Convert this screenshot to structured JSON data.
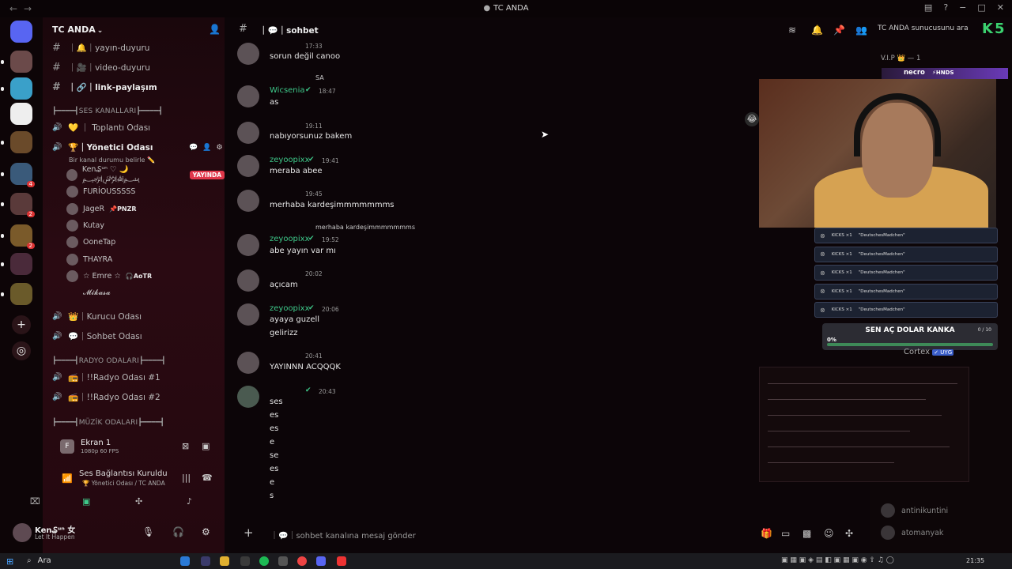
{
  "window": {
    "title": "TC ANDA",
    "controls": [
      "−",
      "□",
      "✕"
    ]
  },
  "server": {
    "name": "TC ANDA"
  },
  "text_channels": [
    {
      "icon": "📢",
      "label": "｜🔔｜yayın-duyuru"
    },
    {
      "icon": "🎥",
      "label": "｜🎥｜video-duyuru"
    },
    {
      "icon": "🔗",
      "label": "｜🔗｜link-paylaşım"
    }
  ],
  "categories": {
    "ses": "┣━━━━┫SES KANALLARI┣━━━━┫",
    "radyo": "┣━━━━┫RADYO ODALARI┣━━━━┫",
    "muzik": "┣━━━━┫MÜZİK ODALARI┣━━━━┫"
  },
  "voice_channels": {
    "toplanti": "💛 ｜ Toplantı Odası",
    "yonetici": "🏆｜Yönetici Odası",
    "yonetici_status": "Bir kanal durumu belirle ✏️",
    "kurucu": "👑｜Kurucu Odası",
    "sohbet": "💬｜Sohbet Odası",
    "radyo1": "📻｜!!Radyo Odası #1",
    "radyo2": "📻｜!!Radyo Odası #2"
  },
  "voice_users": [
    {
      "name": "Ken₷ᵘⁿ ♡ 🌙 ﷽",
      "live": "YAYINDA"
    },
    {
      "name": "FURİOUSSSSS"
    },
    {
      "name": "JageR",
      "tag": "📌PNZR"
    },
    {
      "name": "Kutay"
    },
    {
      "name": "OoneTap"
    },
    {
      "name": "THAYRA"
    },
    {
      "name": "☆ Emre ☆",
      "tag": "🎧AoTR"
    },
    {
      "name": "𝓜𝓲𝓴𝓪𝓼𝓪"
    }
  ],
  "screen_share": {
    "letter": "F",
    "title": "Ekran 1",
    "quality": "1080p 60 FPS"
  },
  "voice_status": {
    "title": "Ses Bağlantısı Kuruldu",
    "subtitle": "🏆 Yönetici Odası / TC ANDA"
  },
  "user_panel": {
    "name": "Ken₷ᵘⁿ 女",
    "status": "Let It Happen"
  },
  "channel_header": {
    "name": "｜💬｜sohbet",
    "search_placeholder": "TC ANDA sunucusunu ara"
  },
  "messages": [
    {
      "time": "17:33",
      "text": "sorun değil canoo"
    },
    {
      "reply": "SA",
      "author": "Wicsenia",
      "time": "18:47",
      "text": "as"
    },
    {
      "time": "19:11",
      "text": "nabıyorsunuz bakem"
    },
    {
      "author": "zeyoopixx",
      "time": "19:41",
      "text": "meraba abee"
    },
    {
      "time": "19:45",
      "text": "merhaba kardeşimmmmmmms"
    },
    {
      "reply": "merhaba kardeşimmmmmmms",
      "author": "zeyoopixx",
      "time": "19:52",
      "text": "abe yayın var mı"
    },
    {
      "time": "20:02",
      "text": "açıcam"
    },
    {
      "author": "zeyoopixx",
      "time": "20:06",
      "text": "ayaya guzell",
      "text2": "gelirizz"
    },
    {
      "time": "20:41",
      "text": "YAYINNN ACQQQK"
    },
    {
      "time": "20:43",
      "lines": [
        "ses",
        "es",
        "es",
        "e",
        "se",
        "es",
        "e",
        "s"
      ]
    }
  ],
  "composer": {
    "placeholder": "｜💬｜sohbet kanalına mesaj gönder"
  },
  "members": {
    "vip_header": "V.I.P 👑 — 1",
    "necro": "necro",
    "necro_tag": "⚡HNDS",
    "cortex": "Cortex",
    "cortex_tag": "✓ UYG",
    "list": [
      "antinikuntini",
      "atomanyak"
    ]
  },
  "alerts": {
    "rows": [
      {
        "who": "KICKS ×1",
        "text": "\"DeutschesMadchen\""
      },
      {
        "who": "KICKS ×1",
        "text": "\"DeutschesMadchen\""
      },
      {
        "who": "KICKS ×1",
        "text": "\"DeutschesMadchen\""
      },
      {
        "who": "KICKS ×1",
        "text": "\"DeutschesMadchen\""
      },
      {
        "who": "KICKS ×1",
        "text": "\"DeutschesMadchen\""
      }
    ]
  },
  "goal": {
    "title": "SEN AÇ DOLAR KANKA",
    "count": "0 / 10",
    "percent": "0%",
    "progress": 0
  },
  "kick_logo": "K5",
  "taskbar": {
    "search": "Ara",
    "clock": "21:35"
  },
  "colors": {
    "accent_green": "#3ec98a",
    "live_red": "#e0374a",
    "kick_green": "#3bd16f"
  }
}
